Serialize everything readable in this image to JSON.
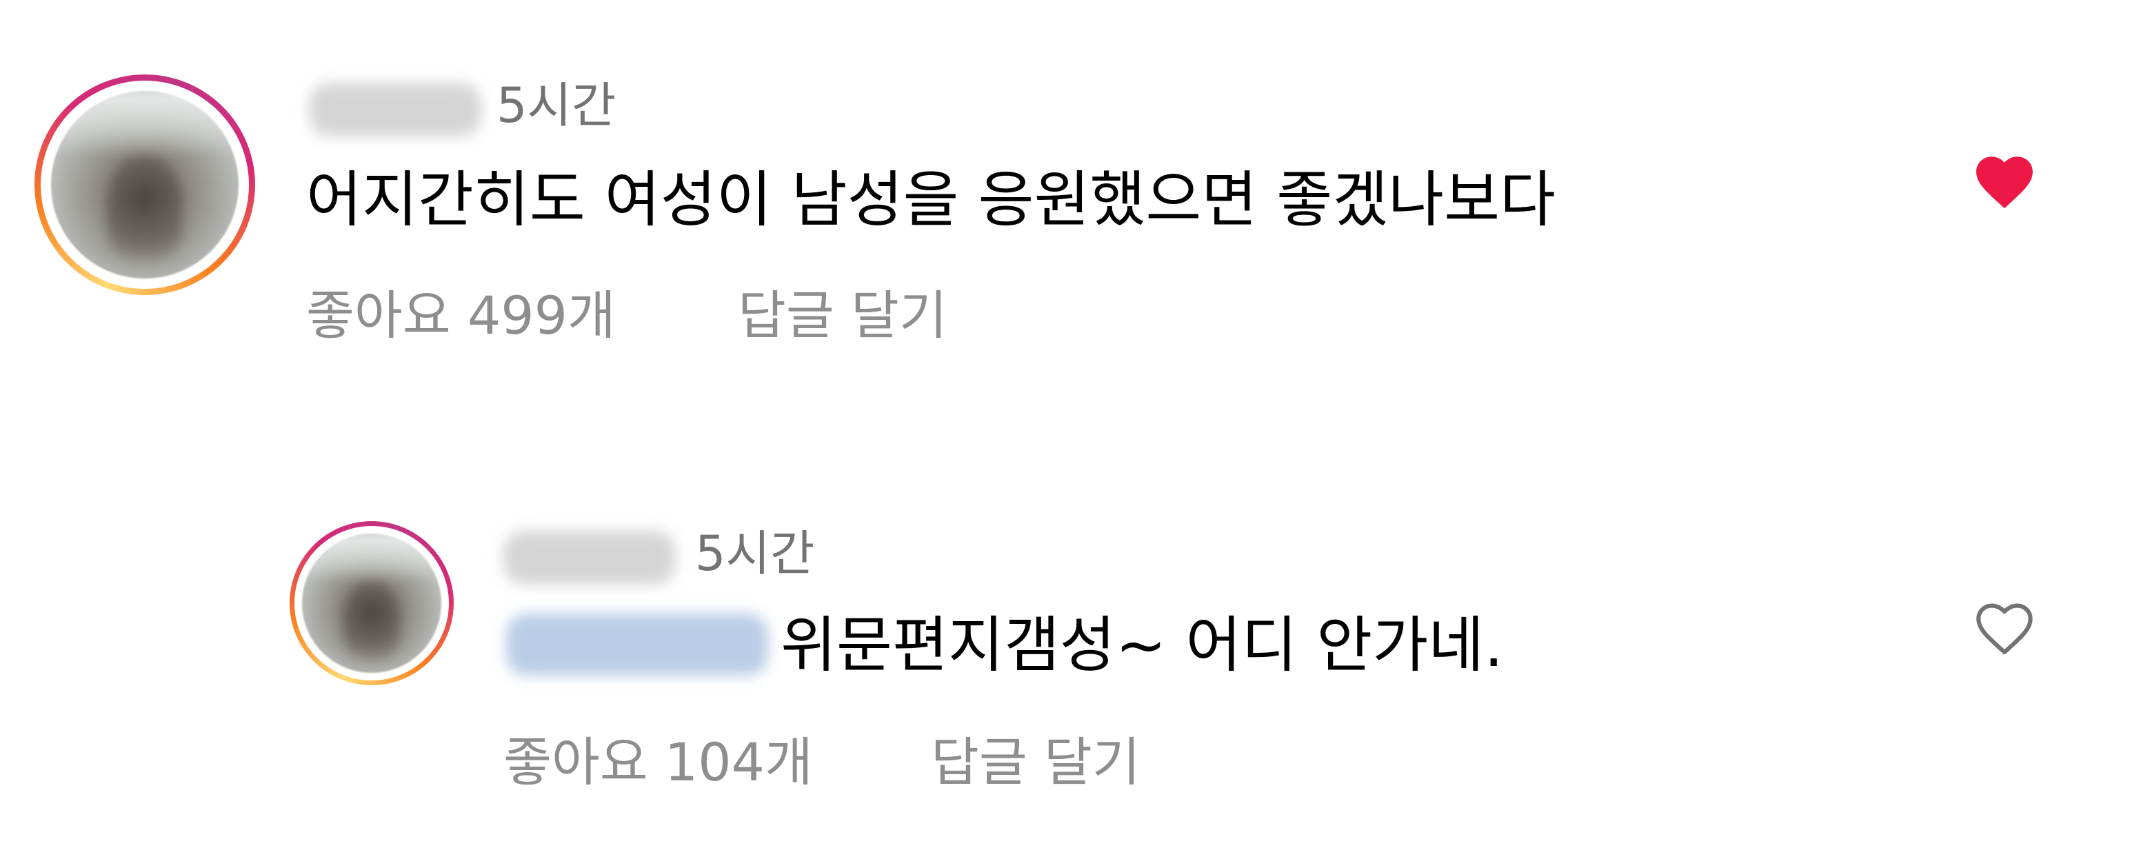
{
  "colors": {
    "liked_heart": "#ed1846",
    "unliked_heart": "#737373",
    "time_text": "#737373",
    "meta_text": "#8e8e8e",
    "body_text": "#000000",
    "mention_blur": "#b9cde6"
  },
  "comments": [
    {
      "time": "5시간",
      "text": "어지간히도 여성이 남성을 응원했으면 좋겠나보다",
      "likes_label": "좋아요 499개",
      "reply_label": "답글 달기",
      "liked": true,
      "like_icon": "heart-filled-icon"
    },
    {
      "time": "5시간",
      "text": "위문편지갬성~ 어디 안가네.",
      "likes_label": "좋아요 104개",
      "reply_label": "답글 달기",
      "liked": false,
      "like_icon": "heart-outline-icon"
    }
  ]
}
